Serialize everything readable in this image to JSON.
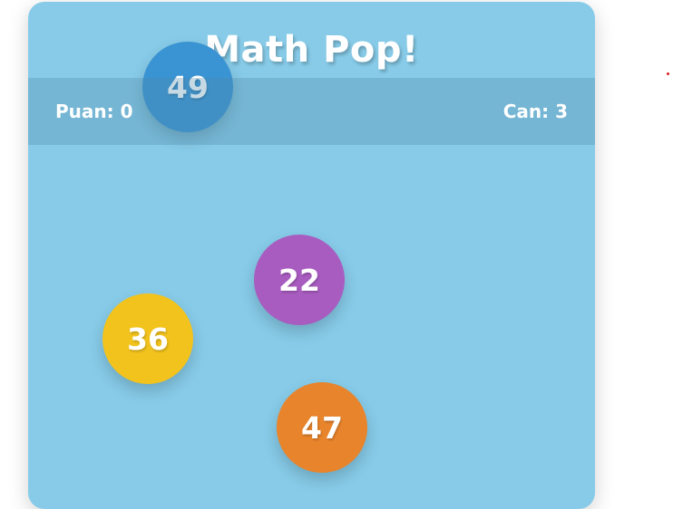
{
  "game": {
    "title": "Math Pop!",
    "score_text": "Puan: 0",
    "lives_text": "Can: 3"
  },
  "bubbles": [
    {
      "value": "49",
      "color": "#3a93d2"
    },
    {
      "value": "22",
      "color": "#a85cc0"
    },
    {
      "value": "36",
      "color": "#f2c31d"
    },
    {
      "value": "47",
      "color": "#e8842c"
    }
  ],
  "colors": {
    "panel_background": "#87cbe8",
    "text": "#ffffff",
    "marker": "#d92020"
  }
}
